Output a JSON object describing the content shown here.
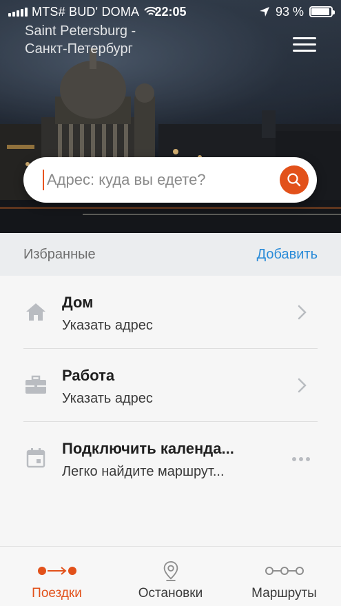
{
  "status_bar": {
    "carrier": "MTS# BUD' DOMA",
    "time": "22:05",
    "battery": "93 %",
    "battery_level": 0.93
  },
  "header": {
    "city_line1": "Saint Petersburg -",
    "city_line2": "Санкт-Петербург"
  },
  "search": {
    "placeholder": "Адрес: куда вы едете?"
  },
  "favorites": {
    "title": "Избранные",
    "add_label": "Добавить",
    "items": [
      {
        "title": "Дом",
        "subtitle": "Указать адрес",
        "icon": "home-icon",
        "action": "chevron-right-icon"
      },
      {
        "title": "Работа",
        "subtitle": "Указать адрес",
        "icon": "briefcase-icon",
        "action": "chevron-right-icon"
      },
      {
        "title": "Подключить календа...",
        "subtitle": "Легко найдите маршрут...",
        "icon": "calendar-icon",
        "action": "more-dots-icon"
      }
    ]
  },
  "tabs": [
    {
      "label": "Поездки",
      "icon": "trips-icon",
      "active": true
    },
    {
      "label": "Остановки",
      "icon": "map-pin-icon",
      "active": false
    },
    {
      "label": "Маршруты",
      "icon": "routes-icon",
      "active": false
    }
  ],
  "colors": {
    "accent": "#e2511a",
    "link": "#2a8bd8",
    "header_bg": "#ebedef"
  }
}
